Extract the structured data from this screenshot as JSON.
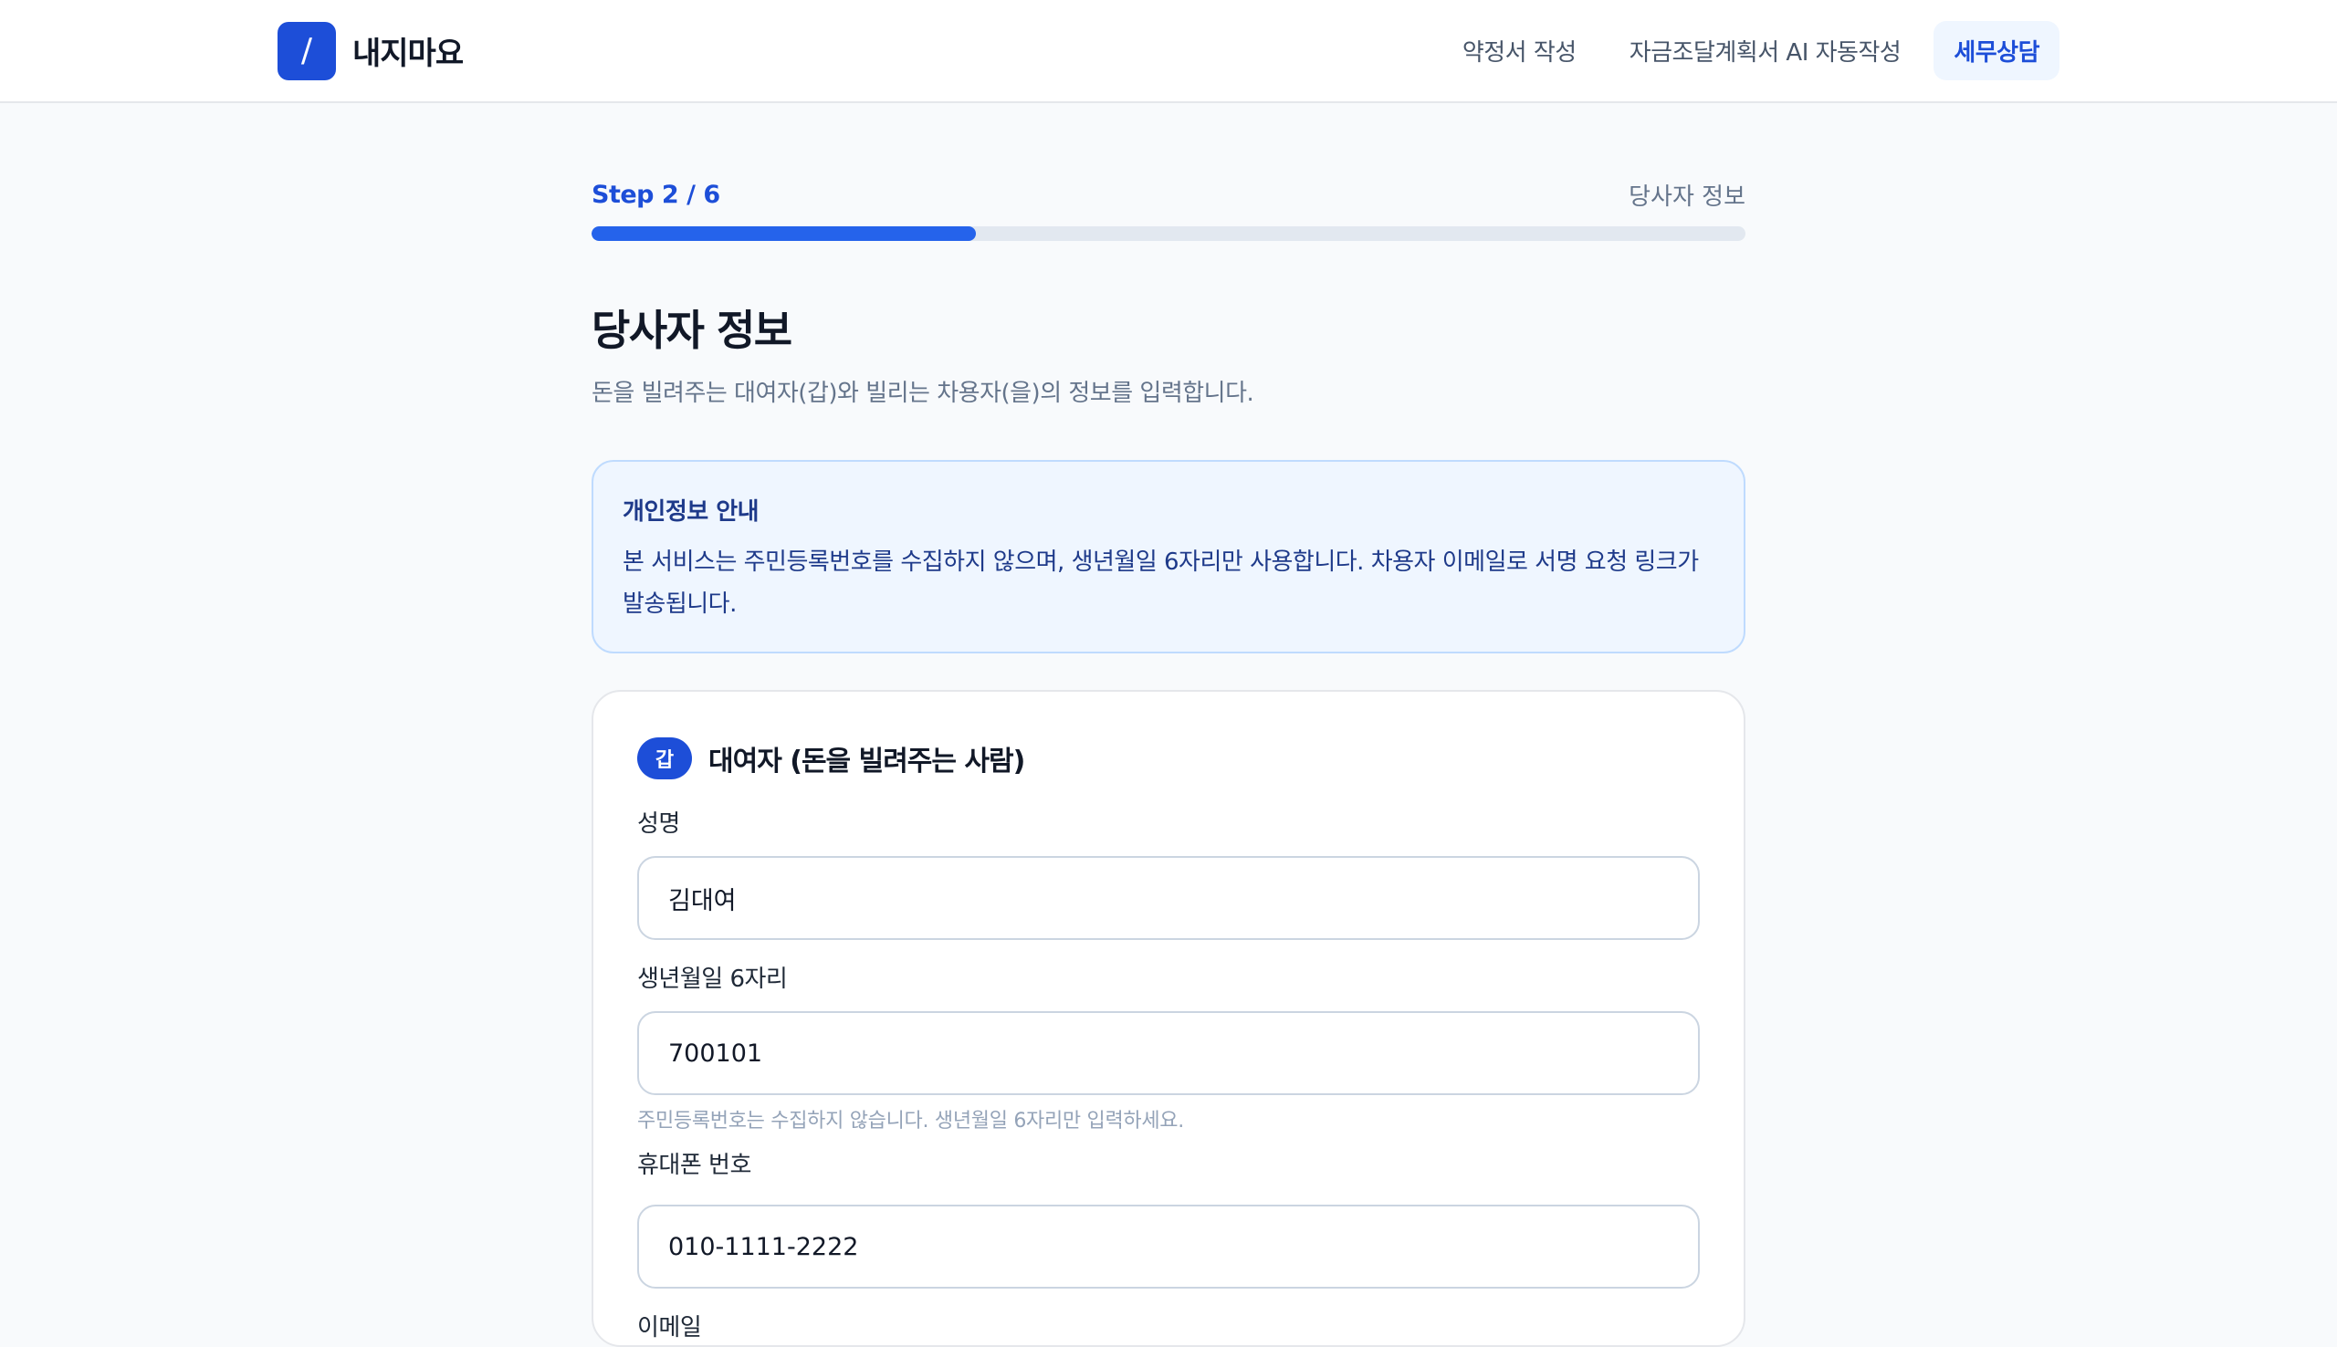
{
  "header": {
    "logo_mark": "/",
    "logo_text": "내지마요",
    "nav": [
      {
        "label": "약정서 작성"
      },
      {
        "label": "자금조달계획서 AI 자동작성"
      },
      {
        "label": "세무상담"
      }
    ],
    "active_nav": "세무상담"
  },
  "progress": {
    "step_label": "Step 2 / 6",
    "current_step": 2,
    "total_steps": 6,
    "fill_fraction": 0.333,
    "step_name": "당사자 정보"
  },
  "page": {
    "title": "당사자 정보",
    "description": "돈을 빌려주는 대여자(갑)와 빌리는 차용자(을)의 정보를 입력합니다."
  },
  "notice": {
    "title": "개인정보 안내",
    "body": "본 서비스는 주민등록번호를 수집하지 않으며, 생년월일 6자리만 사용합니다. 차용자 이메일로 서명 요청 링크가 발송됩니다."
  },
  "lender": {
    "badge": "갑",
    "title": "대여자 (돈을 빌려주는 사람)",
    "name_label": "성명",
    "name_value": "김대여",
    "birth_label": "생년월일 6자리",
    "birth_value": "700101",
    "birth_hint": "주민등록번호는 수집하지 않습니다. 생년월일 6자리만 입력하세요.",
    "phone_label": "휴대폰 번호",
    "phone_value": "010-1111-2222",
    "next_label": "이메일"
  },
  "colors": {
    "accent": "#1d4ed8",
    "progress_fill": "#2563eb",
    "notice_bg": "#eff6ff"
  }
}
